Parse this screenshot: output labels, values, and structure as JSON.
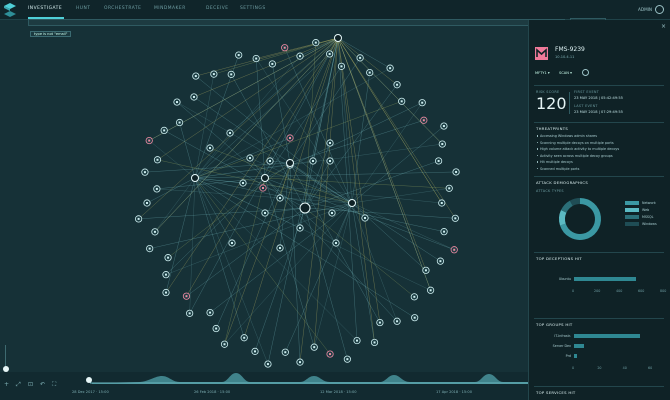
{
  "nav": {
    "tabs": [
      {
        "label": "INVESTIGATE",
        "active": true
      },
      {
        "label": "HUNT",
        "active": false
      },
      {
        "label": "ORCHESTRATE",
        "active": false
      },
      {
        "label": "MINDMAKER",
        "active": false
      },
      {
        "label": "DECEIVE",
        "active": false
      },
      {
        "label": "SETTINGS",
        "active": false
      }
    ],
    "user_label": "ADMIN"
  },
  "search": {
    "value": "",
    "time_filter": "ALL TIME",
    "active_filter": "type is not \"email\""
  },
  "timeline": {
    "labels": [
      "28 Dec 2017 · 15:00",
      "26 Feb 2018 · 15:00",
      "12 Mar 2018 · 15:00",
      "17 Apr 2018 · 15:00"
    ]
  },
  "panel": {
    "attacker_name": "FMS-9239",
    "attacker_ip": "10.10.4.11",
    "tag_button": "MFTY1 ▾",
    "scan_button": "SCAN ▾",
    "risk_label": "RISK SCORE",
    "risk_score": "120",
    "first_event_label": "FIRST EVENT",
    "first_event": "23 MAY 2018 | 05:42:49:55",
    "last_event_label": "LAST EVENT",
    "last_event": "23 MAY 2018 | 07:29:49:55",
    "threatprints_title": "THREATPRINTS",
    "threatprints": [
      "Accessing Windows admin shares",
      "Scanning multiple decoys on multiple ports",
      "High volume attack activity to multiple decoys",
      "Activity seen across multiple decoy groups",
      "Hit multiple decoys",
      "Scanned multiple ports"
    ],
    "demographics_title": "ATTACK DEMOGRAPHICS",
    "attack_types_label": "ATTACK TYPES",
    "attack_types": [
      {
        "name": "Network",
        "value": 70,
        "color": "#3b98a3"
      },
      {
        "name": "Web",
        "value": 12,
        "color": "#5bbac3"
      },
      {
        "name": "MSSQL",
        "value": 10,
        "color": "#2b6f78"
      },
      {
        "name": "Windows",
        "value": 8,
        "color": "#1f4d55"
      }
    ],
    "top_deceptions_title": "TOP DECEPTIONS HIT",
    "top_deceptions": [
      {
        "label": "Ubuntu",
        "value": 560
      }
    ],
    "deceptions_axis": [
      "0",
      "200",
      "400",
      "600",
      "800"
    ],
    "top_groups_title": "TOP GROUPS HIT",
    "top_groups": [
      {
        "label": "IT-Infrastr.",
        "value": 52
      },
      {
        "label": "Server Dev",
        "value": 8
      },
      {
        "label": "Prd",
        "value": 2
      }
    ],
    "groups_axis": [
      "0",
      "20",
      "40",
      "60"
    ],
    "top_services_title": "TOP SERVICES HIT"
  }
}
